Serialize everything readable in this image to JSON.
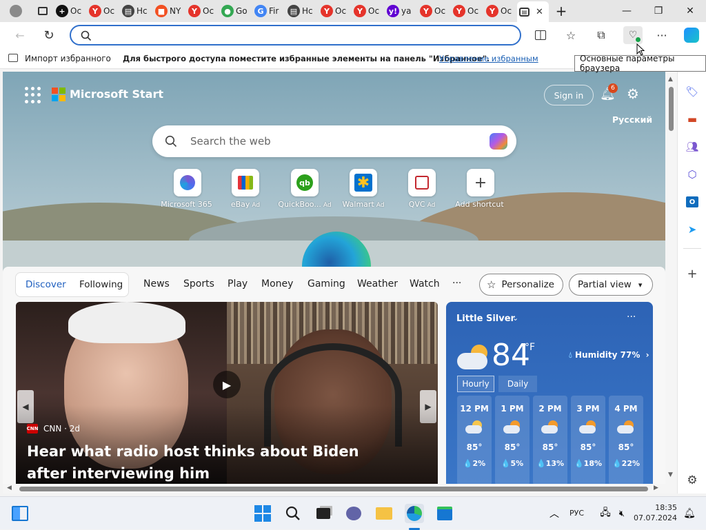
{
  "tabs": [
    {
      "label": "Oc",
      "icon": "plus-circle-icon",
      "color": "#111111",
      "glyph": "+"
    },
    {
      "label": "Oc",
      "icon": "yandex-icon",
      "color": "#e5342b",
      "glyph": "Y"
    },
    {
      "label": "Hc",
      "icon": "news-icon",
      "color": "#444444",
      "glyph": "▤"
    },
    {
      "label": "NY",
      "icon": "msn-icon",
      "color": "#f25022",
      "glyph": "■"
    },
    {
      "label": "Oc",
      "icon": "yandex-icon",
      "color": "#e5342b",
      "glyph": "Y"
    },
    {
      "label": "Go",
      "icon": "maps-pin-icon",
      "color": "#34a853",
      "glyph": "●"
    },
    {
      "label": "Fir",
      "icon": "google-icon",
      "color": "#4285f4",
      "glyph": "G"
    },
    {
      "label": "Hc",
      "icon": "news-icon",
      "color": "#444444",
      "glyph": "▤"
    },
    {
      "label": "Oc",
      "icon": "yandex-icon",
      "color": "#e5342b",
      "glyph": "Y"
    },
    {
      "label": "Oc",
      "icon": "yandex-icon",
      "color": "#e5342b",
      "glyph": "Y"
    },
    {
      "label": "ya",
      "icon": "yahoo-icon",
      "color": "#6001d2",
      "glyph": "y!"
    },
    {
      "label": "Oc",
      "icon": "yandex-icon",
      "color": "#e5342b",
      "glyph": "Y"
    },
    {
      "label": "Oc",
      "icon": "yandex-icon",
      "color": "#e5342b",
      "glyph": "Y"
    },
    {
      "label": "Oc",
      "icon": "yandex-icon",
      "color": "#e5342b",
      "glyph": "Y"
    }
  ],
  "favbar": {
    "import_label": "Импорт избранного",
    "hint": "Для быстрого доступа поместите избранные элементы на панель \"Избранное\".",
    "manage_link": "Управление избранным"
  },
  "tooltip": "Основные параметры браузера",
  "start": {
    "brand": "Microsoft Start",
    "signin": "Sign in",
    "notif_count": "6",
    "language": "Русский",
    "search_placeholder": "Search the web"
  },
  "shortcuts": [
    {
      "label": "Microsoft 365",
      "ad": "",
      "icon": "microsoft365-icon"
    },
    {
      "label": "eBay",
      "ad": "Ad",
      "icon": "ebay-bag-icon"
    },
    {
      "label": "QuickBoo...",
      "ad": "Ad",
      "icon": "quickbooks-icon"
    },
    {
      "label": "Walmart",
      "ad": "Ad",
      "icon": "walmart-icon"
    },
    {
      "label": "QVC",
      "ad": "Ad",
      "icon": "qvc-icon"
    },
    {
      "label": "Add shortcut",
      "ad": "",
      "icon": "plus-icon"
    }
  ],
  "feed_nav": {
    "discover": "Discover",
    "following": "Following",
    "items": [
      "News",
      "Sports",
      "Play",
      "Money",
      "Gaming",
      "Weather",
      "Watch"
    ],
    "more": "···",
    "personalize": "Personalize",
    "view": "Partial view"
  },
  "hero": {
    "source": "CNN · 2d",
    "title": "Hear what radio host thinks about Biden after interviewing him"
  },
  "weather": {
    "location": "Little Silver",
    "temp": "84",
    "unit": "°F",
    "humidity": "Humidity 77%",
    "tab_hourly": "Hourly",
    "tab_daily": "Daily",
    "hours": [
      {
        "time": "12 PM",
        "temp": "85°",
        "precip": "💧2%",
        "icon": "partly-cloudy-icon"
      },
      {
        "time": "1 PM",
        "temp": "85°",
        "precip": "💧5%",
        "icon": "partly-sunny-icon"
      },
      {
        "time": "2 PM",
        "temp": "85°",
        "precip": "💧13%",
        "icon": "partly-sunny-icon"
      },
      {
        "time": "3 PM",
        "temp": "85°",
        "precip": "💧18%",
        "icon": "partly-sunny-icon"
      },
      {
        "time": "4 PM",
        "temp": "85°",
        "precip": "💧22%",
        "icon": "partly-sunny-icon"
      }
    ]
  },
  "taskbar": {
    "lang": "РУС",
    "time": "18:35",
    "date": "07.07.2024"
  }
}
